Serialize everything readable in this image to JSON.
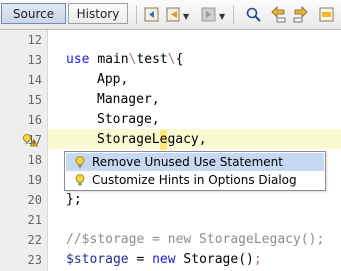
{
  "tabs": [
    {
      "label": "Source",
      "active": true
    },
    {
      "label": "History",
      "active": false
    }
  ],
  "toolbar_icons": [
    "back-icon",
    "back-dropdown-icon",
    "forward-icon",
    "forward-dropdown-icon",
    "find-icon",
    "find-previous-icon",
    "find-next-icon",
    "toggle-highlight-icon"
  ],
  "line_numbers": [
    "12",
    "13",
    "14",
    "15",
    "16",
    "17",
    "18",
    "19",
    "20",
    "21",
    "22",
    "23"
  ],
  "code": {
    "l13": {
      "use": "use ",
      "main": "main",
      "bs1": "\\",
      "test": "test",
      "bs2": "\\",
      "brace": "{"
    },
    "l14": "App,",
    "l15": "Manager,",
    "l16": "Storage,",
    "l17": {
      "before_cursor": "StorageL",
      "cursor_char": "e",
      "after_cursor": "gacy,"
    },
    "l20": "};",
    "l22": "//$storage = new StorageLegacy();",
    "l23": {
      "var": "$storage",
      "eq": " = ",
      "new": "new",
      "rest": " Storage()",
      "semi": ";"
    }
  },
  "popup": {
    "items": [
      {
        "label": "Remove Unused Use Statement",
        "selected": true
      },
      {
        "label": "Customize Hints in Options Dialog",
        "selected": false
      }
    ]
  },
  "colors": {
    "keyword": "#1a1adc",
    "comment": "#8c8c8c",
    "selection": "#c6d9f1",
    "warning_line": "#fafad2"
  }
}
